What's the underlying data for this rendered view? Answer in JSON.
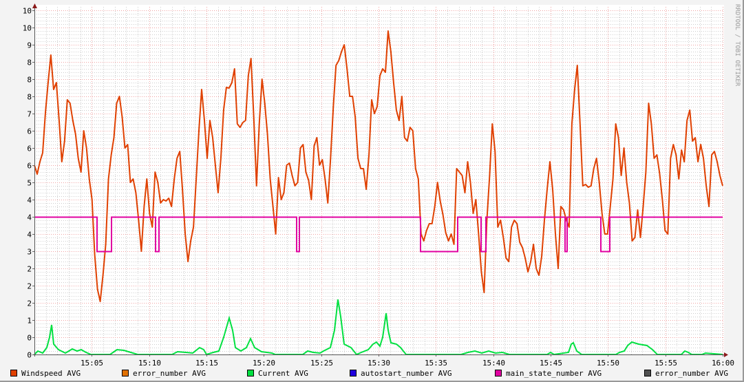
{
  "watermark": "RRDTOOL / TOBI OETIKER",
  "chart_data": {
    "type": "line",
    "title": "",
    "xlabel": "",
    "ylabel": "",
    "xlim_minutes": [
      0,
      60
    ],
    "x_start": "15:00",
    "ylim": [
      0,
      10
    ],
    "grid": true,
    "x_ticks": [
      "15:05",
      "15:10",
      "15:15",
      "15:20",
      "15:25",
      "15:30",
      "15:35",
      "15:40",
      "15:45",
      "15:50",
      "15:55",
      "16:00"
    ],
    "y_ticks": [
      "0",
      "0",
      "1",
      "2",
      "2",
      "2",
      "3",
      "4",
      "4",
      "4",
      "5",
      "6",
      "6",
      "6",
      "7",
      "8",
      "8",
      "8",
      "9",
      "10",
      "10"
    ],
    "y_tick_values": [
      0,
      0.5,
      1,
      1.5,
      2,
      2.5,
      3,
      3.5,
      4,
      4.5,
      5,
      5.5,
      6,
      6.5,
      7,
      7.5,
      8,
      8.5,
      9,
      9.5,
      10
    ],
    "legend_placement": "bottom",
    "legend": [
      {
        "name": "Windspeed AVG",
        "color": "#e04000"
      },
      {
        "name": "error_number AVG",
        "color": "#e07000"
      },
      {
        "name": "Current AVG",
        "color": "#00e040"
      },
      {
        "name": "autostart_number AVG",
        "color": "#2000e0"
      },
      {
        "name": "main_state_number AVG",
        "color": "#e000a0"
      },
      {
        "name": "error_number AVG",
        "color": "#505050"
      }
    ],
    "series": [
      {
        "name": "Windspeed AVG",
        "color": "#e04000",
        "sampling": "evenly spaced over x range",
        "values": [
          5.5,
          5.24,
          5.6,
          5.86,
          7.0,
          7.9,
          8.7,
          7.7,
          7.9,
          6.8,
          5.6,
          6.2,
          7.4,
          7.3,
          6.8,
          6.4,
          5.7,
          5.3,
          6.5,
          6.0,
          5.1,
          4.5,
          2.9,
          1.9,
          1.54,
          2.3,
          3.2,
          5.1,
          5.8,
          6.3,
          7.3,
          7.5,
          6.9,
          6.0,
          6.1,
          5.0,
          5.1,
          4.7,
          3.9,
          3.0,
          4.3,
          5.1,
          4.1,
          3.7,
          5.3,
          5.0,
          4.4,
          4.5,
          4.46,
          4.54,
          4.3,
          5.1,
          5.7,
          5.9,
          4.8,
          3.5,
          2.7,
          3.3,
          3.7,
          5.1,
          6.5,
          7.7,
          6.8,
          5.7,
          6.8,
          6.3,
          5.5,
          4.7,
          5.7,
          7.1,
          7.76,
          7.74,
          7.9,
          8.3,
          6.7,
          6.6,
          6.74,
          6.8,
          8.1,
          8.6,
          6.9,
          4.9,
          6.7,
          8.0,
          7.3,
          6.4,
          5.1,
          4.3,
          3.5,
          5.14,
          4.5,
          4.7,
          5.5,
          5.56,
          5.2,
          4.9,
          5.0,
          6.0,
          6.1,
          5.3,
          5.06,
          4.5,
          6.06,
          6.3,
          5.5,
          5.66,
          5.1,
          4.4,
          5.7,
          7.2,
          8.4,
          8.54,
          8.8,
          9.0,
          8.3,
          7.5,
          7.5,
          6.9,
          5.7,
          5.4,
          5.4,
          4.8,
          5.8,
          7.4,
          7.0,
          7.2,
          8.1,
          8.3,
          8.2,
          9.4,
          8.8,
          7.9,
          7.1,
          6.8,
          7.5,
          6.3,
          6.2,
          6.6,
          6.5,
          5.4,
          5.1,
          3.5,
          3.3,
          3.6,
          3.8,
          3.8,
          4.3,
          5.0,
          4.46,
          4.06,
          3.54,
          3.3,
          3.5,
          3.2,
          5.4,
          5.3,
          5.2,
          4.7,
          5.6,
          5.0,
          4.1,
          4.5,
          3.5,
          2.4,
          1.8,
          3.9,
          5.2,
          6.7,
          5.9,
          3.7,
          3.9,
          3.4,
          2.8,
          2.7,
          3.7,
          3.9,
          3.8,
          3.26,
          3.1,
          2.8,
          2.4,
          2.7,
          3.2,
          2.5,
          2.3,
          2.86,
          3.9,
          4.8,
          5.6,
          4.8,
          3.5,
          2.5,
          4.3,
          4.2,
          3.9,
          3.7,
          6.7,
          7.7,
          8.4,
          6.7,
          4.9,
          4.94,
          4.86,
          4.9,
          5.4,
          5.7,
          5.0,
          4.1,
          3.5,
          3.5,
          4.3,
          5.1,
          6.7,
          6.3,
          5.2,
          6.0,
          5.0,
          4.4,
          3.3,
          3.4,
          4.2,
          3.4,
          4.3,
          5.3,
          7.3,
          6.7,
          5.7,
          5.8,
          5.26,
          4.5,
          3.6,
          3.5,
          5.7,
          6.1,
          5.8,
          5.1,
          5.94,
          5.6,
          6.8,
          7.1,
          6.2,
          6.3,
          5.6,
          6.1,
          5.7,
          4.9,
          4.3,
          5.8,
          5.9,
          5.6,
          5.2,
          4.9
        ]
      },
      {
        "name": "Current AVG",
        "color": "#00e040",
        "points": [
          [
            0,
            0
          ],
          [
            0.3,
            0.1
          ],
          [
            0.72,
            0.04
          ],
          [
            1.08,
            0.2
          ],
          [
            1.32,
            0.5
          ],
          [
            1.5,
            0.86
          ],
          [
            1.68,
            0.3
          ],
          [
            2.1,
            0.14
          ],
          [
            2.7,
            0.04
          ],
          [
            3.0,
            0.1
          ],
          [
            3.3,
            0.16
          ],
          [
            3.72,
            0.1
          ],
          [
            4.08,
            0.14
          ],
          [
            4.5,
            0.06
          ],
          [
            4.92,
            0
          ],
          [
            6.6,
            0
          ],
          [
            7.2,
            0.14
          ],
          [
            7.8,
            0.12
          ],
          [
            8.4,
            0.06
          ],
          [
            9.0,
            0
          ],
          [
            12.0,
            0
          ],
          [
            12.48,
            0.08
          ],
          [
            13.2,
            0.06
          ],
          [
            13.8,
            0.04
          ],
          [
            14.4,
            0.2
          ],
          [
            14.76,
            0.14
          ],
          [
            15.0,
            0
          ],
          [
            15.6,
            0.06
          ],
          [
            16.08,
            0.1
          ],
          [
            16.5,
            0.5
          ],
          [
            16.98,
            1.06
          ],
          [
            17.28,
            0.7
          ],
          [
            17.52,
            0.2
          ],
          [
            18.0,
            0.1
          ],
          [
            18.48,
            0.2
          ],
          [
            18.84,
            0.46
          ],
          [
            19.2,
            0.2
          ],
          [
            19.8,
            0.08
          ],
          [
            20.7,
            0.04
          ],
          [
            21.0,
            0
          ],
          [
            23.4,
            0
          ],
          [
            23.82,
            0.1
          ],
          [
            24.3,
            0.06
          ],
          [
            24.9,
            0.04
          ],
          [
            25.2,
            0.1
          ],
          [
            25.8,
            0.2
          ],
          [
            26.16,
            0.7
          ],
          [
            26.46,
            1.6
          ],
          [
            26.7,
            1.1
          ],
          [
            27.0,
            0.3
          ],
          [
            27.6,
            0.2
          ],
          [
            28.08,
            0
          ],
          [
            28.5,
            0.06
          ],
          [
            29.1,
            0.14
          ],
          [
            29.52,
            0.3
          ],
          [
            29.82,
            0.36
          ],
          [
            30.12,
            0.24
          ],
          [
            30.36,
            0.5
          ],
          [
            30.66,
            1.2
          ],
          [
            30.84,
            0.7
          ],
          [
            31.08,
            0.34
          ],
          [
            31.56,
            0.3
          ],
          [
            31.92,
            0.2
          ],
          [
            32.4,
            0
          ],
          [
            37.2,
            0
          ],
          [
            37.8,
            0.06
          ],
          [
            38.4,
            0.1
          ],
          [
            39.0,
            0.04
          ],
          [
            39.6,
            0.1
          ],
          [
            40.2,
            0.04
          ],
          [
            40.8,
            0.06
          ],
          [
            41.4,
            0
          ],
          [
            44.7,
            0
          ],
          [
            45.0,
            0.06
          ],
          [
            45.3,
            0
          ],
          [
            46.56,
            0.06
          ],
          [
            46.8,
            0.3
          ],
          [
            46.98,
            0.34
          ],
          [
            47.28,
            0.1
          ],
          [
            47.7,
            0
          ],
          [
            50.7,
            0
          ],
          [
            51.0,
            0.06
          ],
          [
            51.42,
            0.1
          ],
          [
            51.72,
            0.26
          ],
          [
            52.08,
            0.36
          ],
          [
            52.68,
            0.3
          ],
          [
            53.4,
            0.26
          ],
          [
            53.88,
            0.14
          ],
          [
            54.3,
            0
          ],
          [
            56.4,
            0
          ],
          [
            56.7,
            0.1
          ],
          [
            57.0,
            0.06
          ],
          [
            57.3,
            0
          ],
          [
            58.2,
            0
          ],
          [
            58.5,
            0.04
          ],
          [
            60,
            0
          ]
        ]
      },
      {
        "name": "main_state_number AVG",
        "color": "#e000a0",
        "base_value": 4,
        "dips_to": 3,
        "dip_intervals_minutes": [
          [
            5.46,
            6.72
          ],
          [
            10.56,
            10.86
          ],
          [
            22.86,
            23.1
          ],
          [
            33.66,
            36.9
          ],
          [
            38.94,
            39.36
          ],
          [
            46.26,
            46.44
          ],
          [
            49.38,
            50.16
          ]
        ]
      }
    ]
  }
}
